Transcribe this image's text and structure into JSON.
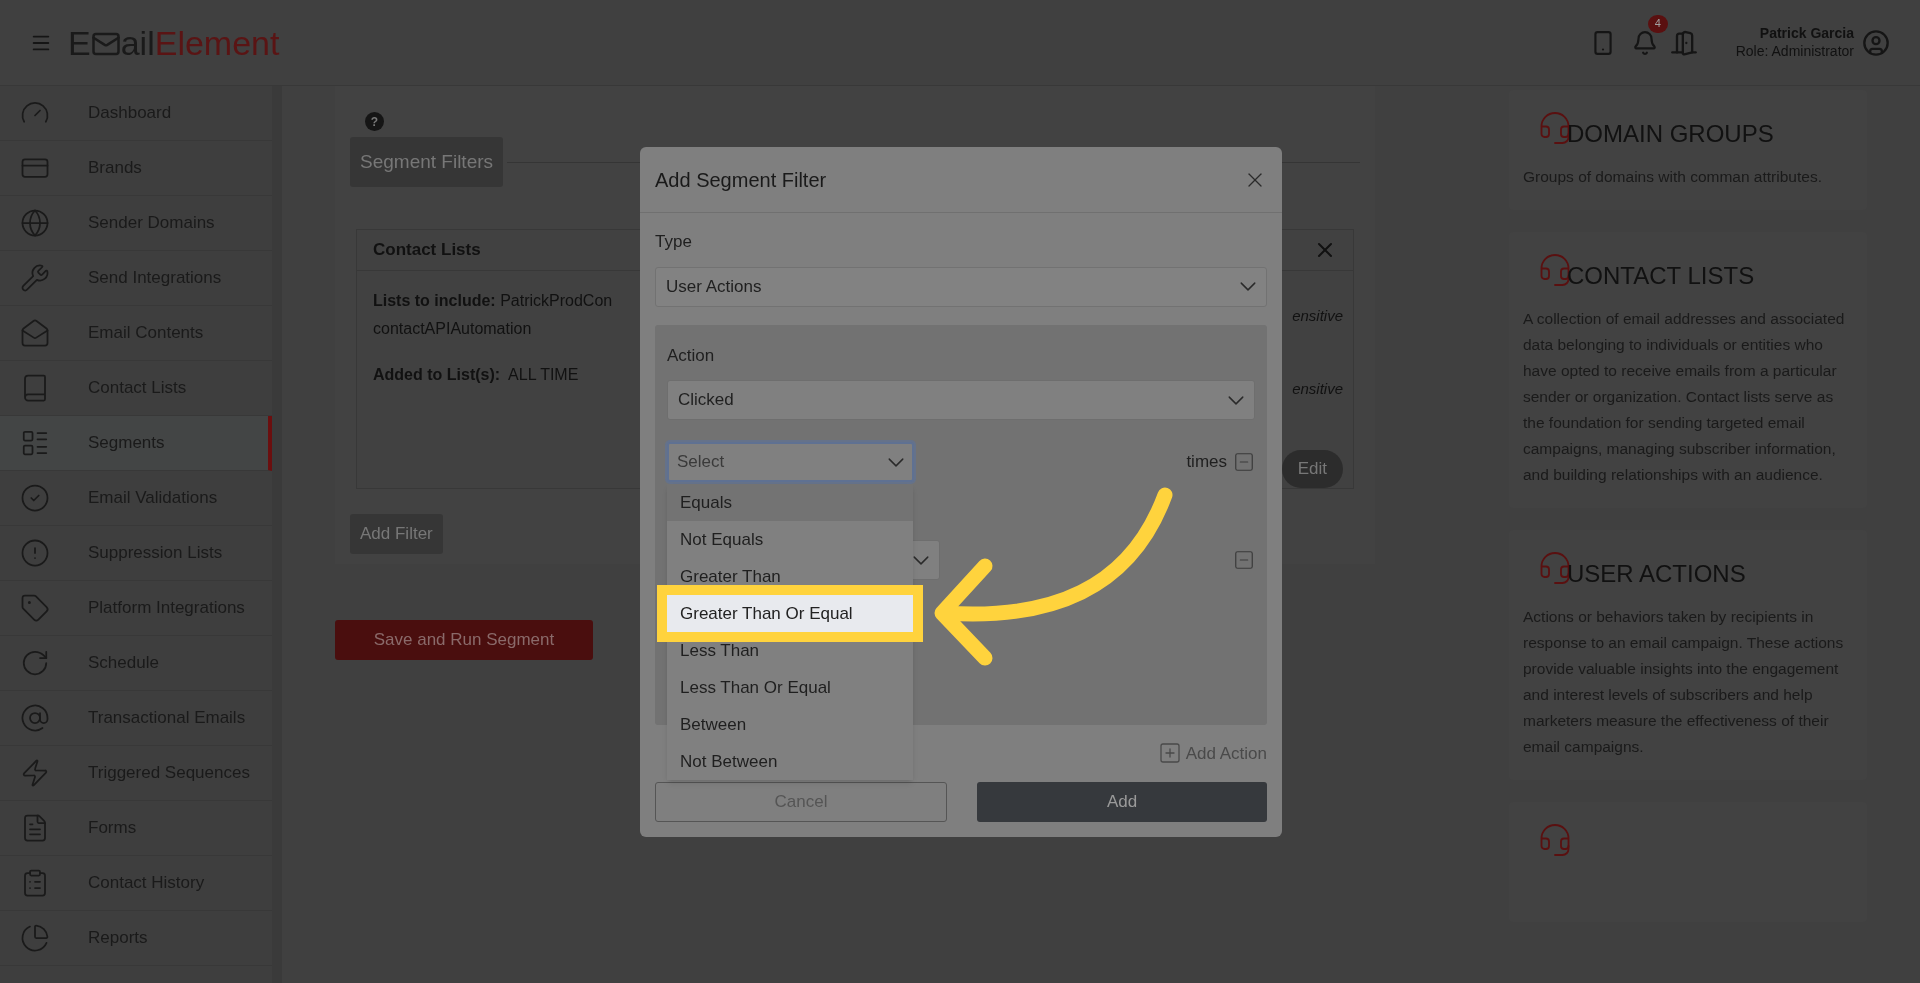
{
  "header": {
    "logo": {
      "part_1": "E",
      "part_2": "ail",
      "part_3": "Element"
    },
    "notification_count": "4",
    "user": {
      "name": "Patrick Garcia",
      "role": "Role: Administrator"
    }
  },
  "sidebar": {
    "items": [
      {
        "label": "Dashboard",
        "selected": false
      },
      {
        "label": "Brands",
        "selected": false
      },
      {
        "label": "Sender Domains",
        "selected": false
      },
      {
        "label": "Send Integrations",
        "selected": false
      },
      {
        "label": "Email Contents",
        "selected": false
      },
      {
        "label": "Contact Lists",
        "selected": false
      },
      {
        "label": "Segments",
        "selected": true
      },
      {
        "label": "Email Validations",
        "selected": false
      },
      {
        "label": "Suppression Lists",
        "selected": false
      },
      {
        "label": "Platform Integrations",
        "selected": false
      },
      {
        "label": "Schedule",
        "selected": false
      },
      {
        "label": "Transactional Emails",
        "selected": false
      },
      {
        "label": "Triggered Sequences",
        "selected": false
      },
      {
        "label": "Forms",
        "selected": false
      },
      {
        "label": "Contact History",
        "selected": false
      },
      {
        "label": "Reports",
        "selected": false
      }
    ]
  },
  "main": {
    "help": "?",
    "tab": "Segment Filters",
    "filter_card": {
      "title": "Contact Lists",
      "lists_label": "Lists to include:",
      "lists_value": "PatrickProdCon",
      "lists_value_2": "contactAPIAutomation",
      "added_label": "Added to List(s):",
      "added_value": "ALL TIME",
      "right_texts": [
        "ensitive",
        "ensitive"
      ],
      "edit": "Edit"
    },
    "add_filter": "Add Filter",
    "save": "Save and Run Segment"
  },
  "info_cards": [
    {
      "title": "DOMAIN GROUPS",
      "text": "Groups of domains with comman attributes."
    },
    {
      "title": "CONTACT LISTS",
      "text": "A collection of email addresses and associated data belonging to individuals or entities who have opted to receive emails from a particular sender or organization. Contact lists serve as the foundation for sending targeted email campaigns, managing subscriber information, and building relationships with an audience."
    },
    {
      "title": "USER ACTIONS",
      "text": "Actions or behaviors taken by recipients in response to an email campaign. These actions provide valuable insights into the engagement and interest levels of subscribers and help marketers measure the effectiveness of their email campaigns."
    }
  ],
  "modal": {
    "title": "Add Segment Filter",
    "type_label": "Type",
    "type_value": "User Actions",
    "action_label": "Action",
    "action_value": "Clicked",
    "operator_placeholder": "Select",
    "times": "times",
    "operator_options": [
      {
        "label": "Equals",
        "hovered": true,
        "highlighted": false
      },
      {
        "label": "Not Equals",
        "hovered": false,
        "highlighted": false
      },
      {
        "label": "Greater Than",
        "hovered": false,
        "highlighted": false
      },
      {
        "label": "Greater Than Or Equal",
        "hovered": false,
        "highlighted": true
      },
      {
        "label": "Less Than",
        "hovered": false,
        "highlighted": false
      },
      {
        "label": "Less Than Or Equal",
        "hovered": false,
        "highlighted": false
      },
      {
        "label": "Between",
        "hovered": false,
        "highlighted": false
      },
      {
        "label": "Not Between",
        "hovered": false,
        "highlighted": false
      }
    ],
    "add_action": "Add Action",
    "cancel": "Cancel",
    "add": "Add"
  }
}
